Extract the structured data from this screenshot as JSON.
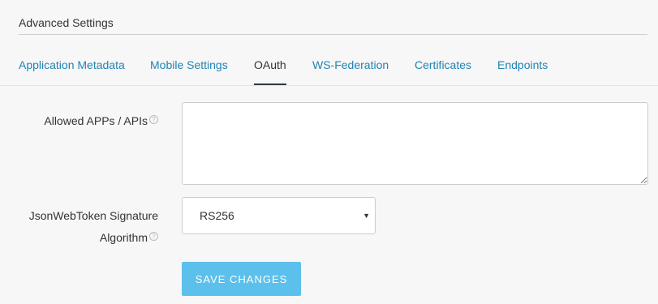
{
  "section": {
    "title": "Advanced Settings"
  },
  "tabs": [
    {
      "label": "Application Metadata",
      "active": false
    },
    {
      "label": "Mobile Settings",
      "active": false
    },
    {
      "label": "OAuth",
      "active": true
    },
    {
      "label": "WS-Federation",
      "active": false
    },
    {
      "label": "Certificates",
      "active": false
    },
    {
      "label": "Endpoints",
      "active": false
    }
  ],
  "fields": {
    "allowed_apps": {
      "label": "Allowed APPs / APIs",
      "value": ""
    },
    "jwt_algorithm": {
      "label_line1": "JsonWebToken Signature",
      "label_line2": "Algorithm",
      "value": "RS256"
    }
  },
  "help_icon_glyph": "?",
  "actions": {
    "save_label": "SAVE CHANGES"
  },
  "colors": {
    "link": "#1f84b4",
    "button": "#5bc0eb",
    "active_tab_underline": "#2d3a44"
  }
}
